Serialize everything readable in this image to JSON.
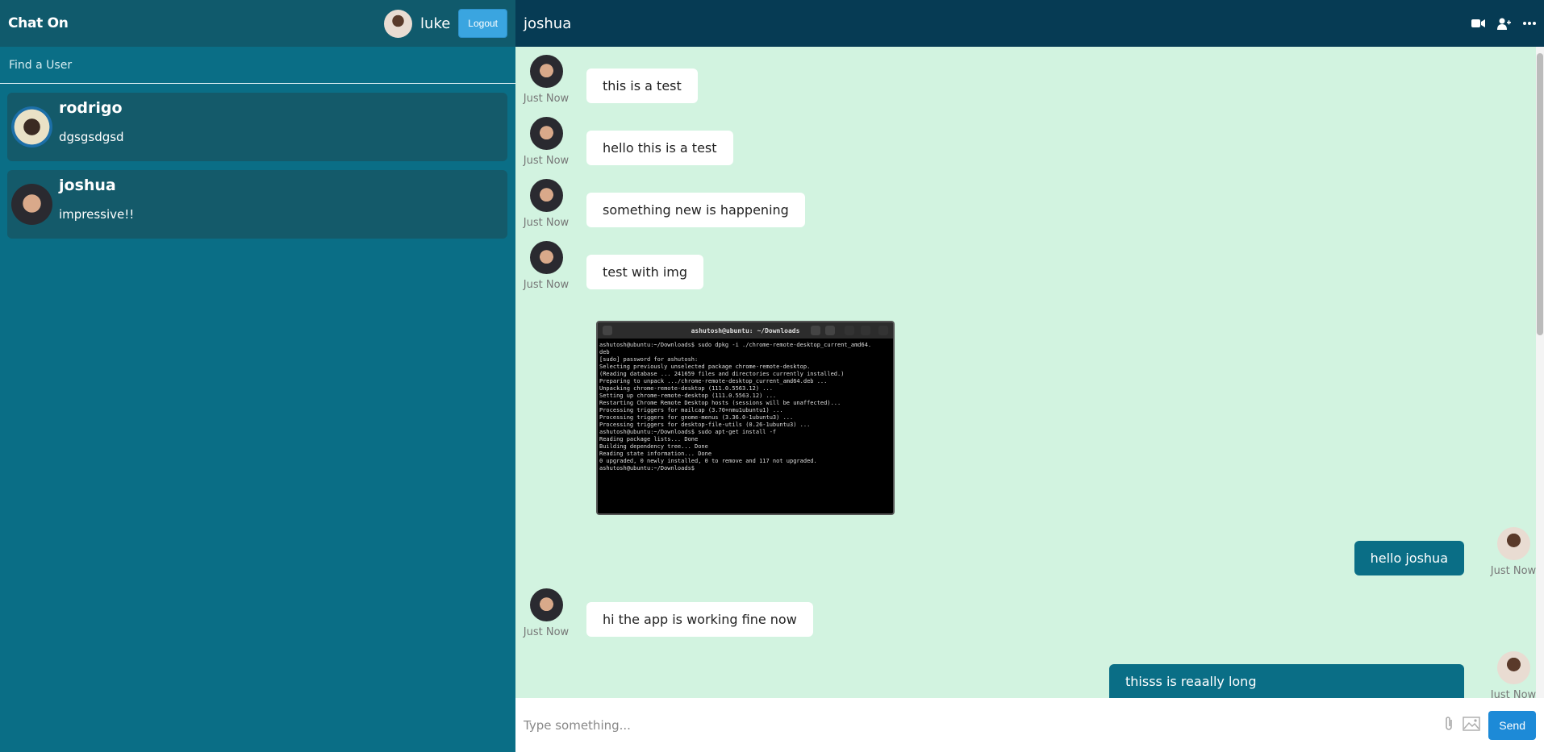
{
  "sidebar": {
    "brand": "Chat On",
    "current_user": "luke",
    "logout_label": "Logout",
    "search_placeholder": "Find a User",
    "contacts": [
      {
        "name": "rodrigo",
        "last_message": "dgsgsdgsd"
      },
      {
        "name": "joshua",
        "last_message": "impressive!!"
      }
    ]
  },
  "chat": {
    "title": "joshua",
    "messages": [
      {
        "from": "joshua",
        "text": "this is a test",
        "time": "Just Now"
      },
      {
        "from": "joshua",
        "text": "hello this is a test",
        "time": "Just Now"
      },
      {
        "from": "joshua",
        "text": "something new is happening",
        "time": "Just Now"
      },
      {
        "from": "joshua",
        "text": "test with img",
        "time": "Just Now"
      },
      {
        "from": "joshua",
        "type": "image",
        "terminal": {
          "title": "ashutosh@ubuntu: ~/Downloads",
          "lines": [
            "ashutosh@ubuntu:~/Downloads$ sudo dpkg -i ./chrome-remote-desktop_current_amd64.",
            "deb",
            "[sudo] password for ashutosh:",
            "Selecting previously unselected package chrome-remote-desktop.",
            "(Reading database ... 241659 files and directories currently installed.)",
            "Preparing to unpack .../chrome-remote-desktop_current_amd64.deb ...",
            "Unpacking chrome-remote-desktop (111.0.5563.12) ...",
            "Setting up chrome-remote-desktop (111.0.5563.12) ...",
            "Restarting Chrome Remote Desktop hosts (sessions will be unaffected)...",
            "Processing triggers for mailcap (3.70+nmu1ubuntu1) ...",
            "Processing triggers for gnome-menus (3.36.0-1ubuntu3) ...",
            "Processing triggers for desktop-file-utils (0.26-1ubuntu3) ...",
            "ashutosh@ubuntu:~/Downloads$ sudo apt-get install -f",
            "Reading package lists... Done",
            "Building dependency tree... Done",
            "Reading state information... Done",
            "0 upgraded, 0 newly installed, 0 to remove and 117 not upgraded.",
            "ashutosh@ubuntu:~/Downloads$"
          ]
        }
      },
      {
        "from": "luke",
        "text": "hello joshua",
        "time": "Just Now"
      },
      {
        "from": "joshua",
        "text": "hi the app is working fine now",
        "time": "Just Now"
      },
      {
        "from": "luke",
        "text": "thisss is reaally long",
        "time": "Just Now"
      }
    ]
  },
  "composer": {
    "placeholder": "Type something...",
    "send_label": "Send"
  },
  "icons": {
    "header": [
      "video-icon",
      "add-user-icon",
      "more-icon"
    ],
    "composer": [
      "attach-icon",
      "image-icon"
    ]
  },
  "colors": {
    "sidebar_bg": "#0a6e86",
    "sidebar_header_bg": "#105a6c",
    "chat_header_bg": "#063b54",
    "chat_bg": "#d2f3e0",
    "outgoing_bubble": "#0a6e86",
    "send_button": "#1d8ad7"
  }
}
